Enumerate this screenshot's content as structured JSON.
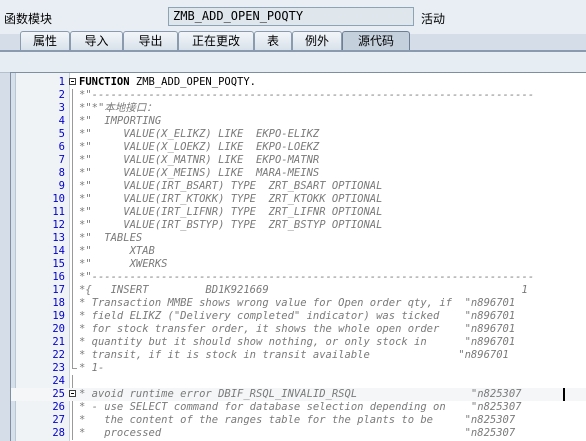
{
  "header": {
    "label": "函数模块",
    "function_name": "ZMB_ADD_OPEN_POQTY",
    "status": "活动"
  },
  "tabs": [
    {
      "label": "属性"
    },
    {
      "label": "导入"
    },
    {
      "label": "导出"
    },
    {
      "label": "正在更改"
    },
    {
      "label": "表"
    },
    {
      "label": "例外"
    },
    {
      "label": "源代码"
    }
  ],
  "active_tab": "源代码",
  "editor": {
    "lines": [
      {
        "num": "1",
        "text": "FUNCTION ZMB_ADD_OPEN_POQTY.",
        "kind": "code"
      },
      {
        "num": "2",
        "text": "*\"----------------------------------------------------------------------",
        "kind": "comment"
      },
      {
        "num": "3",
        "text": "*\"*\"本地接口：",
        "kind": "comment"
      },
      {
        "num": "4",
        "text": "*\"  IMPORTING",
        "kind": "comment"
      },
      {
        "num": "5",
        "text": "*\"     VALUE(X_ELIKZ) LIKE  EKPO-ELIKZ",
        "kind": "comment"
      },
      {
        "num": "6",
        "text": "*\"     VALUE(X_LOEKZ) LIKE  EKPO-LOEKZ",
        "kind": "comment"
      },
      {
        "num": "7",
        "text": "*\"     VALUE(X_MATNR) LIKE  EKPO-MATNR",
        "kind": "comment"
      },
      {
        "num": "8",
        "text": "*\"     VALUE(X_MEINS) LIKE  MARA-MEINS",
        "kind": "comment"
      },
      {
        "num": "9",
        "text": "*\"     VALUE(IRT_BSART) TYPE  ZRT_BSART OPTIONAL",
        "kind": "comment"
      },
      {
        "num": "10",
        "text": "*\"     VALUE(IRT_KTOKK) TYPE  ZRT_KTOKK OPTIONAL",
        "kind": "comment"
      },
      {
        "num": "11",
        "text": "*\"     VALUE(IRT_LIFNR) TYPE  ZRT_LIFNR OPTIONAL",
        "kind": "comment"
      },
      {
        "num": "12",
        "text": "*\"     VALUE(IRT_BSTYP) TYPE  ZRT_BSTYP OPTIONAL",
        "kind": "comment"
      },
      {
        "num": "13",
        "text": "*\"  TABLES",
        "kind": "comment"
      },
      {
        "num": "14",
        "text": "*\"      XTAB",
        "kind": "comment"
      },
      {
        "num": "15",
        "text": "*\"      XWERKS",
        "kind": "comment"
      },
      {
        "num": "16",
        "text": "*\"----------------------------------------------------------------------",
        "kind": "comment"
      },
      {
        "num": "17",
        "text": "*{   INSERT         BD1K921669                                        1",
        "kind": "comment"
      },
      {
        "num": "18",
        "text": "* Transaction MMBE shows wrong value for Open order qty, if  \"n896701",
        "kind": "comment"
      },
      {
        "num": "19",
        "text": "* field ELIKZ (\"Delivery completed\" indicator) was ticked    \"n896701",
        "kind": "comment"
      },
      {
        "num": "20",
        "text": "* for stock transfer order, it shows the whole open order    \"n896701",
        "kind": "comment"
      },
      {
        "num": "21",
        "text": "* quantity but it should show nothing, or only stock in      \"n896701",
        "kind": "comment"
      },
      {
        "num": "22",
        "text": "* transit, if it is stock in transit available              \"n896701",
        "kind": "comment"
      },
      {
        "num": "23",
        "text": "* 1-",
        "kind": "comment"
      },
      {
        "num": "24",
        "text": "",
        "kind": "blank"
      },
      {
        "num": "25",
        "text": "* avoid runtime error DBIF_RSQL_INVALID_RSQL                  \"n825307",
        "kind": "comment"
      },
      {
        "num": "26",
        "text": "* - use SELECT command for database selection depending on    \"n825307",
        "kind": "comment"
      },
      {
        "num": "27",
        "text": "*   the content of the ranges table for the plants to be     \"n825307",
        "kind": "comment"
      },
      {
        "num": "28",
        "text": "*   processed                                                \"n825307",
        "kind": "comment"
      }
    ]
  }
}
